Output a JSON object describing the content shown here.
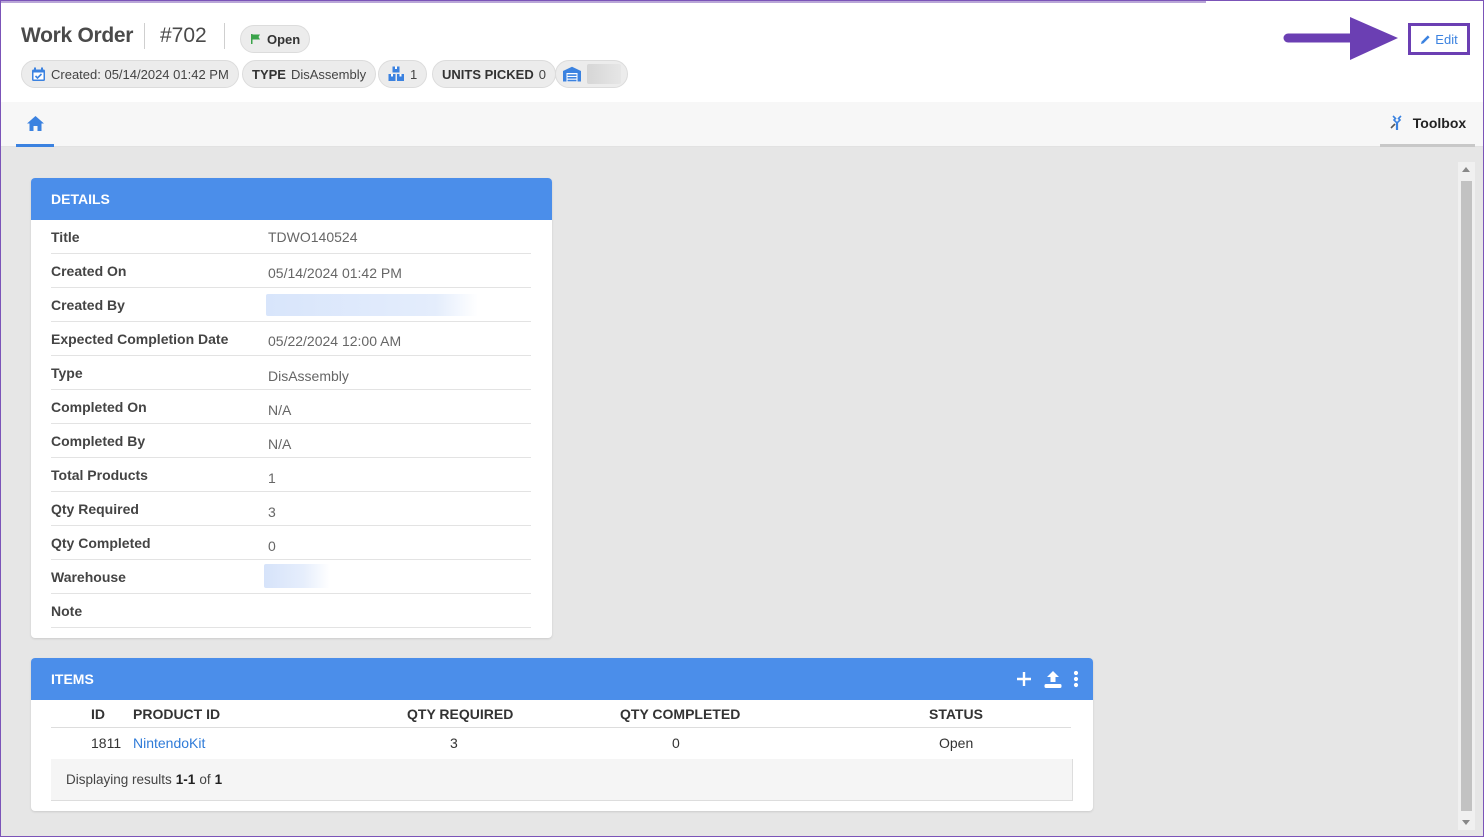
{
  "header": {
    "title": "Work Order",
    "number": "#702",
    "status": "Open",
    "created": "Created: 05/14/2024 01:42 PM",
    "type_label": "TYPE",
    "type_value": "DisAssembly",
    "product_count": "1",
    "units_picked_label": "UNITS PICKED",
    "units_picked_value": "0",
    "edit_label": "Edit"
  },
  "colors": {
    "accent": "#4b8eea",
    "link": "#2f7bd8",
    "annotation": "#6b3fb3",
    "status_flag": "#3aa34a"
  },
  "tabs": {
    "toolbox_label": "Toolbox"
  },
  "details": {
    "heading": "DETAILS",
    "rows": [
      {
        "label": "Title",
        "value": "TDWO140524"
      },
      {
        "label": "Created On",
        "value": "05/14/2024 01:42 PM"
      },
      {
        "label": "Created By",
        "value": ""
      },
      {
        "label": "Expected Completion Date",
        "value": "05/22/2024 12:00 AM"
      },
      {
        "label": "Type",
        "value": "DisAssembly"
      },
      {
        "label": "Completed On",
        "value": "N/A"
      },
      {
        "label": "Completed By",
        "value": "N/A"
      },
      {
        "label": "Total Products",
        "value": "1"
      },
      {
        "label": "Qty Required",
        "value": "3"
      },
      {
        "label": "Qty Completed",
        "value": "0"
      },
      {
        "label": "Warehouse",
        "value": ""
      },
      {
        "label": "Note",
        "value": ""
      }
    ]
  },
  "items": {
    "heading": "ITEMS",
    "columns": [
      "ID",
      "PRODUCT ID",
      "QTY REQUIRED",
      "QTY COMPLETED",
      "STATUS"
    ],
    "rows": [
      {
        "id": "1811",
        "product_id": "NintendoKit",
        "qty_required": "3",
        "qty_completed": "0",
        "status": "Open"
      }
    ],
    "footer_prefix": "Displaying results",
    "footer_range": "1-1",
    "footer_of": "of",
    "footer_total": "1"
  }
}
